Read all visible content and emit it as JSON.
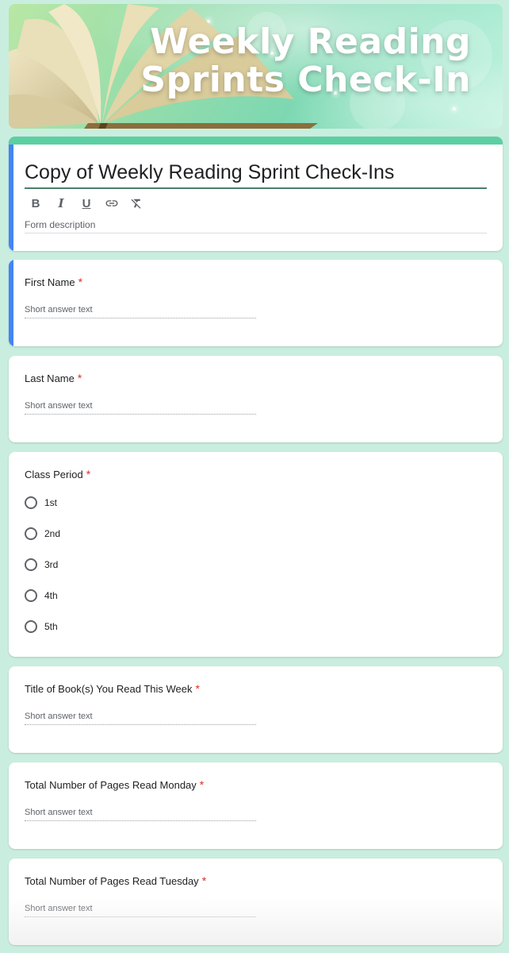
{
  "banner": {
    "title_line1": "Weekly Reading",
    "title_line2": "Sprints Check-In"
  },
  "form": {
    "title": "Copy of Weekly Reading Sprint Check-Ins",
    "description_placeholder": "Form description",
    "toolbar": {
      "bold": "B",
      "italic": "I",
      "underline": "U"
    }
  },
  "questions": [
    {
      "label": "First Name",
      "required_mark": "*",
      "answer_placeholder": "Short answer text"
    },
    {
      "label": "Last Name",
      "required_mark": "*",
      "answer_placeholder": "Short answer text"
    },
    {
      "label": "Class Period",
      "required_mark": "*",
      "options": [
        "1st",
        "2nd",
        "3rd",
        "4th",
        "5th"
      ]
    },
    {
      "label": "Title of Book(s) You Read This Week",
      "required_mark": "*",
      "answer_placeholder": "Short answer text"
    },
    {
      "label": "Total Number of Pages Read Monday",
      "required_mark": "*",
      "answer_placeholder": "Short answer text"
    },
    {
      "label": "Total Number of Pages Read Tuesday",
      "required_mark": "*",
      "answer_placeholder": "Short answer text"
    }
  ],
  "colors": {
    "accent_blue": "#4285f4",
    "theme_green": "#5ccfa3",
    "background": "#c9eedf",
    "required_red": "#d93025"
  }
}
